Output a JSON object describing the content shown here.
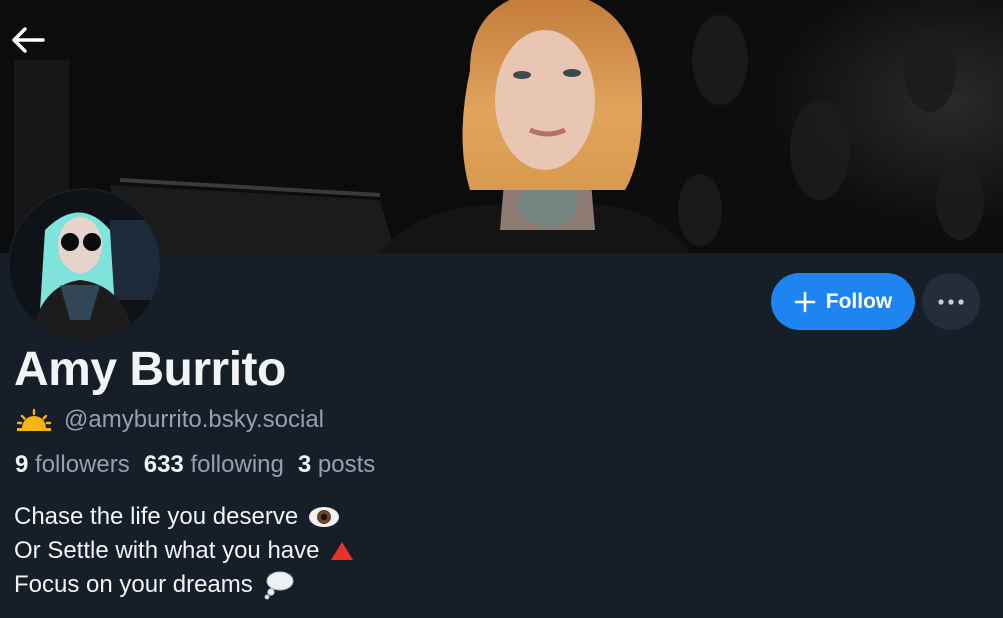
{
  "profile": {
    "display_name": "Amy Burrito",
    "handle": "@amyburrito.bsky.social",
    "handle_emoji": "sunrise-icon"
  },
  "stats": {
    "followers_count": "9",
    "followers_label": "followers",
    "following_count": "633",
    "following_label": "following",
    "posts_count": "3",
    "posts_label": "posts"
  },
  "actions": {
    "follow_label": "Follow"
  },
  "bio": [
    {
      "text": "Chase the life you deserve",
      "emoji": "eye-icon"
    },
    {
      "text": "Or Settle with what you have",
      "emoji": "red-triangle-icon"
    },
    {
      "text": "Focus on your dreams",
      "emoji": "thought-bubble-icon"
    }
  ],
  "colors": {
    "background": "#161e27",
    "accent": "#1d84f0",
    "muted_text": "#93a1b1"
  }
}
